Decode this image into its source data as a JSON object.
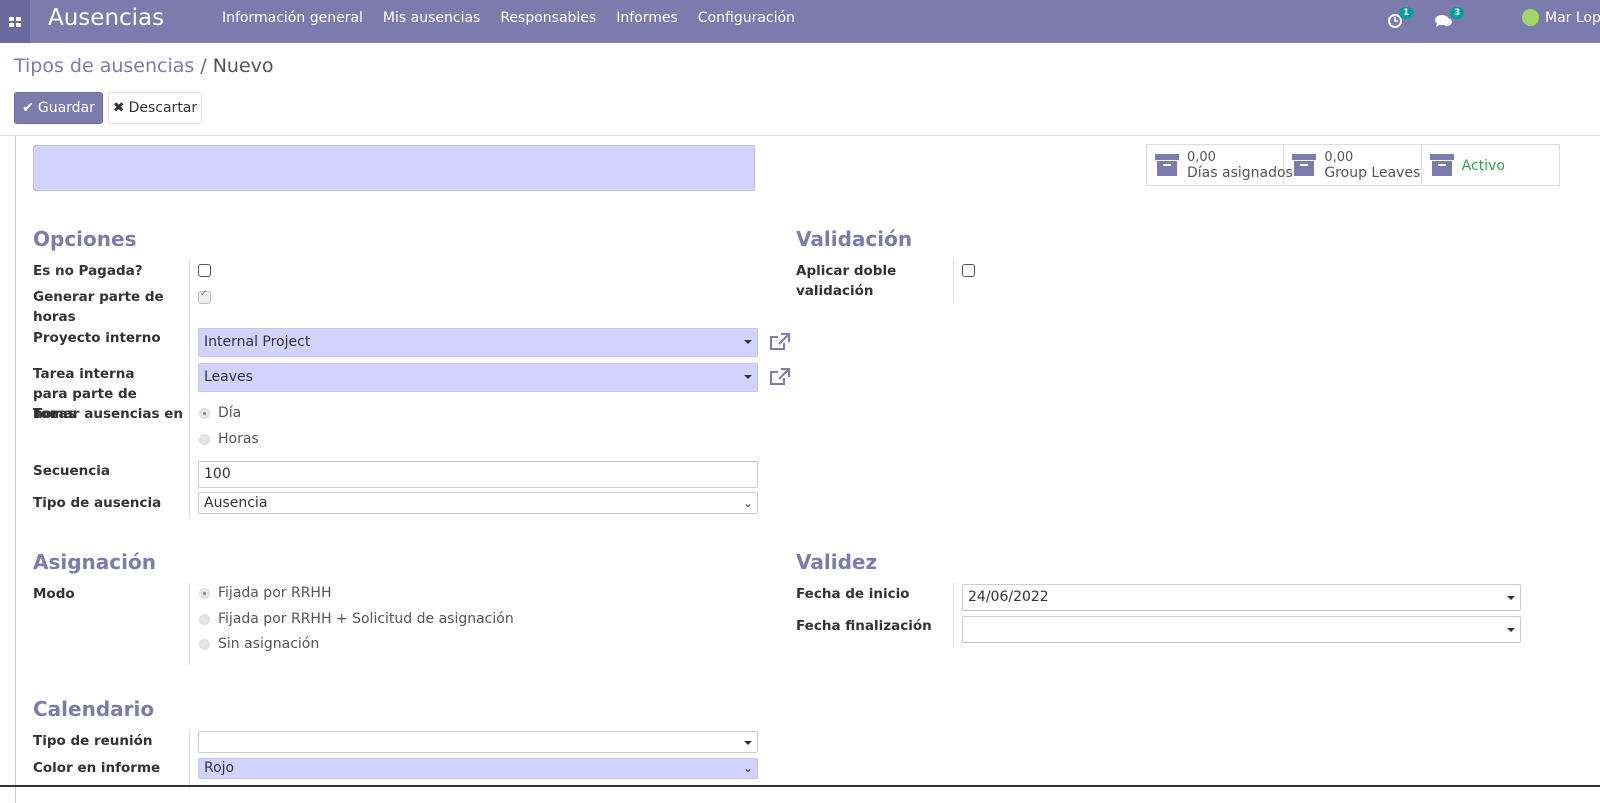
{
  "navbar": {
    "app_title": "Ausencias",
    "menu": [
      "Información general",
      "Mis ausencias",
      "Responsables",
      "Informes",
      "Configuración"
    ],
    "activity_count": "1",
    "messages_count": "3",
    "user_name": "Mar Lopez",
    "color": "#7c7bad"
  },
  "breadcrumb": {
    "parent": "Tipos de ausencias",
    "separator": "/",
    "current": "Nuevo"
  },
  "buttons": {
    "save": "Guardar",
    "discard": "Descartar"
  },
  "stats": [
    {
      "value": "0,00",
      "label": "Días asignados",
      "icon": "archive-icon"
    },
    {
      "value": "0,00",
      "label": "Group Leaves",
      "icon": "archive-icon"
    },
    {
      "value": "",
      "label": "Activo",
      "icon": "archive-icon"
    }
  ],
  "options": {
    "title": "Opciones",
    "unpaid_label": "Es no Pagada?",
    "timesheet_label": "Generar parte de horas",
    "project_label": "Proyecto interno",
    "project_value": "Internal Project",
    "task_label": "Tarea interna para parte de horas",
    "task_value": "Leaves",
    "take_label": "Tomar ausencias en",
    "take_options": [
      "Día",
      "Horas"
    ],
    "take_selected": "Día",
    "sequence_label": "Secuencia",
    "sequence_value": "100",
    "type_label": "Tipo de ausencia",
    "type_value": "Ausencia"
  },
  "validation": {
    "title": "Validación",
    "double_label": "Aplicar doble validación"
  },
  "allocation": {
    "title": "Asignación",
    "mode_label": "Modo",
    "mode_options": [
      "Fijada por RRHH",
      "Fijada por RRHH + Solicitud de asignación",
      "Sin asignación"
    ],
    "mode_selected": "Fijada por RRHH"
  },
  "validity": {
    "title": "Validez",
    "start_label": "Fecha de inicio",
    "start_value": "24/06/2022",
    "end_label": "Fecha finalización",
    "end_value": ""
  },
  "calendar": {
    "title": "Calendario",
    "meeting_label": "Tipo de reunión",
    "meeting_value": "",
    "color_label": "Color en informe",
    "color_value": "Rojo"
  },
  "colors": {
    "accent": "#7c7bad",
    "required_field": "#d2d2ff",
    "active": "#28a745"
  }
}
